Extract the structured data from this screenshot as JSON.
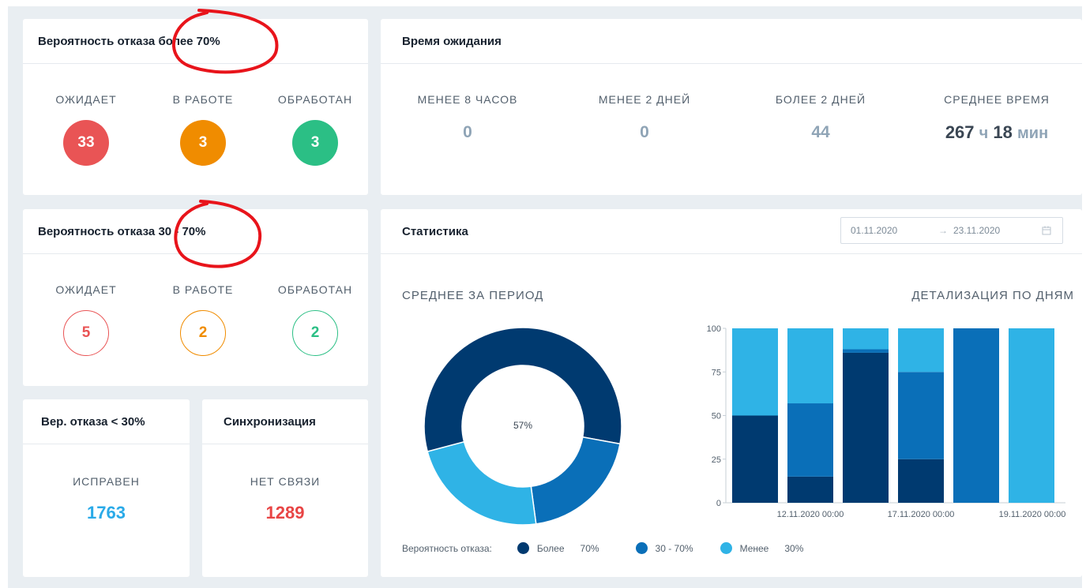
{
  "card_high": {
    "title": "Вероятность отказа более 70%",
    "items": [
      {
        "label": "ОЖИДАЕТ",
        "value": "33",
        "color": "#e95455"
      },
      {
        "label": "В РАБОТЕ",
        "value": "3",
        "color": "#f08c00"
      },
      {
        "label": "ОБРАБОТАН",
        "value": "3",
        "color": "#2bbf85"
      }
    ]
  },
  "card_mid": {
    "title": "Вероятность отказа 30 - 70%",
    "items": [
      {
        "label": "ОЖИДАЕТ",
        "value": "5",
        "color": "#e95455"
      },
      {
        "label": "В РАБОТЕ",
        "value": "2",
        "color": "#f08c00"
      },
      {
        "label": "ОБРАБОТАН",
        "value": "2",
        "color": "#2bbf85"
      }
    ]
  },
  "card_low": {
    "title": "Вер. отказа < 30%",
    "label": "ИСПРАВЕН",
    "value": "1763"
  },
  "card_sync": {
    "title": "Синхронизация",
    "label": "НЕТ СВЯЗИ",
    "value": "1289"
  },
  "waiting": {
    "title": "Время ожидания",
    "cols": [
      {
        "label": "МЕНЕЕ 8 ЧАСОВ",
        "value": "0"
      },
      {
        "label": "МЕНЕЕ 2 ДНЕЙ",
        "value": "0"
      },
      {
        "label": "БОЛЕЕ 2 ДНЕЙ",
        "value": "44"
      }
    ],
    "avg_label": "СРЕДНЕЕ ВРЕМЯ",
    "avg_hours": "267",
    "avg_h_unit": "ч",
    "avg_minutes": "18",
    "avg_m_unit": "мин"
  },
  "stats": {
    "title": "Статистика",
    "date_from": "01.11.2020",
    "date_arrow": "→",
    "date_to": "23.11.2020",
    "avg_title": "СРЕДНЕЕ ЗА ПЕРИОД",
    "detail_title": "ДЕТАЛИЗАЦИЯ ПО ДНЯМ",
    "legend_label": "Вероятность отказа:",
    "legend": [
      {
        "name": "Более",
        "value": "70%",
        "color": "#003a70"
      },
      {
        "name": "",
        "value": "30 - 70%",
        "color": "#0a6fb8"
      },
      {
        "name": "Менее",
        "value": "30%",
        "color": "#2fb3e6"
      }
    ]
  },
  "chart_data": [
    {
      "type": "pie",
      "center_label": "57%",
      "values": [
        57,
        20,
        23
      ],
      "colors": [
        "#003a70",
        "#0a6fb8",
        "#2fb3e6"
      ]
    },
    {
      "type": "bar",
      "stacked": true,
      "ylim": [
        0,
        100
      ],
      "yticks": [
        "0",
        "25",
        "50",
        "75",
        "100"
      ],
      "xtick_labels": [
        "12.11.2020 00:00",
        "17.11.2020 00:00",
        "19.11.2020 00:00"
      ],
      "series": [
        {
          "values": [
            50,
            15,
            86,
            25,
            0,
            0
          ],
          "color": "#003a70"
        },
        {
          "values": [
            0,
            42,
            2,
            50,
            100,
            0
          ],
          "color": "#0a6fb8"
        },
        {
          "values": [
            50,
            43,
            12,
            25,
            0,
            100
          ],
          "color": "#2fb3e6"
        }
      ]
    }
  ]
}
